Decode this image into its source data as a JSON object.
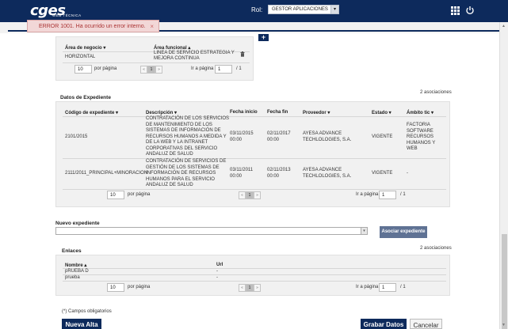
{
  "header": {
    "logo_text": "cges",
    "logo_sub": "WEB TÉCNICA",
    "rol_label": "Rol:",
    "rol_value": "GESTOR APLICACIONES",
    "apps_icon": "grid-icon",
    "logout_icon": "power-icon"
  },
  "error": {
    "message": "ERROR 1001. Ha ocurrido un error interno.",
    "close": "×"
  },
  "areas": {
    "columns": [
      "Área de negocio",
      "Área funcional"
    ],
    "rows": [
      {
        "negocio": "HORIZONTAL",
        "funcional_1": "LINEA DE SERVICIO ESTRATEGIA Y",
        "funcional_2": "MEJORA CONTINUA"
      }
    ],
    "pager": {
      "size": "10",
      "per_page": "por página",
      "page": "1",
      "go_label": "Ir a página",
      "go_value": "1",
      "total": "/ 1"
    }
  },
  "expedientes": {
    "title": "Datos de Expediente",
    "count": "2 asociaciones",
    "columns": [
      "Código de expediente",
      "Descripción",
      "Fecha inicio",
      "Fecha fin",
      "Proveedor",
      "Estado",
      "Ámbito tic"
    ],
    "rows": [
      {
        "codigo": "2101/2015",
        "descripcion": [
          "CONTRATACIÓN DE LOS SERVICIOS",
          "DE MANTENIMIENTO DE LOS",
          "SISTEMAS DE INFORMACIÓN DE",
          "RECURSOS HUMANOS A MEDIDA Y",
          "DE LA WEB Y LA INTRANET",
          "CORPORATIVAS DEL SERVICIO",
          "ANDALUZ DE SALUD"
        ],
        "inicio": [
          "03/11/2015",
          "00:00"
        ],
        "fin": [
          "02/11/2017",
          "00:00"
        ],
        "proveedor": [
          "AYESA ADVANCE",
          "TECHLOLOGIES, S.A."
        ],
        "estado": "VIGENTE",
        "ambito": [
          "FACTORIA",
          "SOFTWARE",
          "RECURSOS",
          "HUMANOS Y",
          "WEB"
        ]
      },
      {
        "codigo": "2111/2011_PRINCIPAL+MINORACION",
        "descripcion": [
          "CONTRATACIÓN DE SERVICIOS DE",
          "GESTIÓN DE LOS SISTEMAS DE",
          "INFORMACIÓN DE RECURSOS",
          "HUMANOS PARA EL SERVICIO",
          "ANDALUZ DE SALUD"
        ],
        "inicio": [
          "03/11/2011",
          "00:00"
        ],
        "fin": [
          "02/11/2013",
          "00:00"
        ],
        "proveedor": [
          "AYESA ADVANCE",
          "TECHLOLOGIES, S.A."
        ],
        "estado": "VIGENTE",
        "ambito": [
          "-"
        ]
      }
    ],
    "pager": {
      "size": "10",
      "per_page": "por página",
      "page": "1",
      "go_label": "Ir a página",
      "go_value": "1",
      "total": "/ 1"
    }
  },
  "nuevo": {
    "label": "Nuevo expediente",
    "button": "Asociar expediente"
  },
  "enlaces": {
    "title": "Enlaces",
    "count": "2 asociaciones",
    "columns": [
      "Nombre",
      "Url"
    ],
    "rows": [
      {
        "nombre": "pRUEBA D",
        "url": "-"
      },
      {
        "nombre": "prueba",
        "url": "-"
      }
    ],
    "pager": {
      "size": "10",
      "per_page": "por página",
      "page": "1",
      "go_label": "Ir a página",
      "go_value": "1",
      "total": "/ 1"
    }
  },
  "footer": {
    "required_note": "(*) Campos obligatorios",
    "nueva_alta": "Nueva Alta",
    "grabar": "Grabar Datos",
    "cancelar": "Cancelar"
  },
  "colors": {
    "navy": "#0d2a5c",
    "error_bg": "#f2d7d7",
    "asociar_btn": "#5f7294"
  }
}
